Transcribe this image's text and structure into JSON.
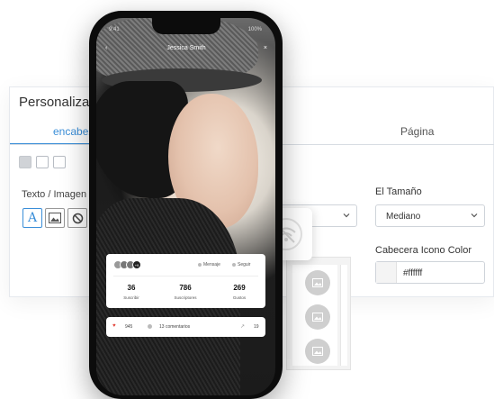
{
  "panel": {
    "title": "Personaliza fr",
    "tab_left": "encabez",
    "tab_right": "Página",
    "text_image_label": "Texto / Imagen",
    "size_label": "El Tamaño",
    "size_value": "Mediano",
    "color_label": "Cabecera Icono Color",
    "color_value": "#ffffff"
  },
  "phone": {
    "time": "9:41",
    "battery": "100%",
    "back_glyph": "‹",
    "profile_name": "Jessica Smith",
    "close_glyph": "×",
    "avatar_more": "+9",
    "actions": {
      "message": "Mensaje",
      "follow": "Seguir"
    },
    "stats": [
      {
        "value": "36",
        "label": "Suscribir"
      },
      {
        "value": "786",
        "label": "Suscriptores"
      },
      {
        "value": "269",
        "label": "Gustos"
      }
    ],
    "engagement": {
      "likes": "945",
      "comments": "13 comentarios",
      "shares": "19"
    }
  },
  "colors": {
    "accent": "#3a8ed8",
    "like": "#e2443b"
  }
}
